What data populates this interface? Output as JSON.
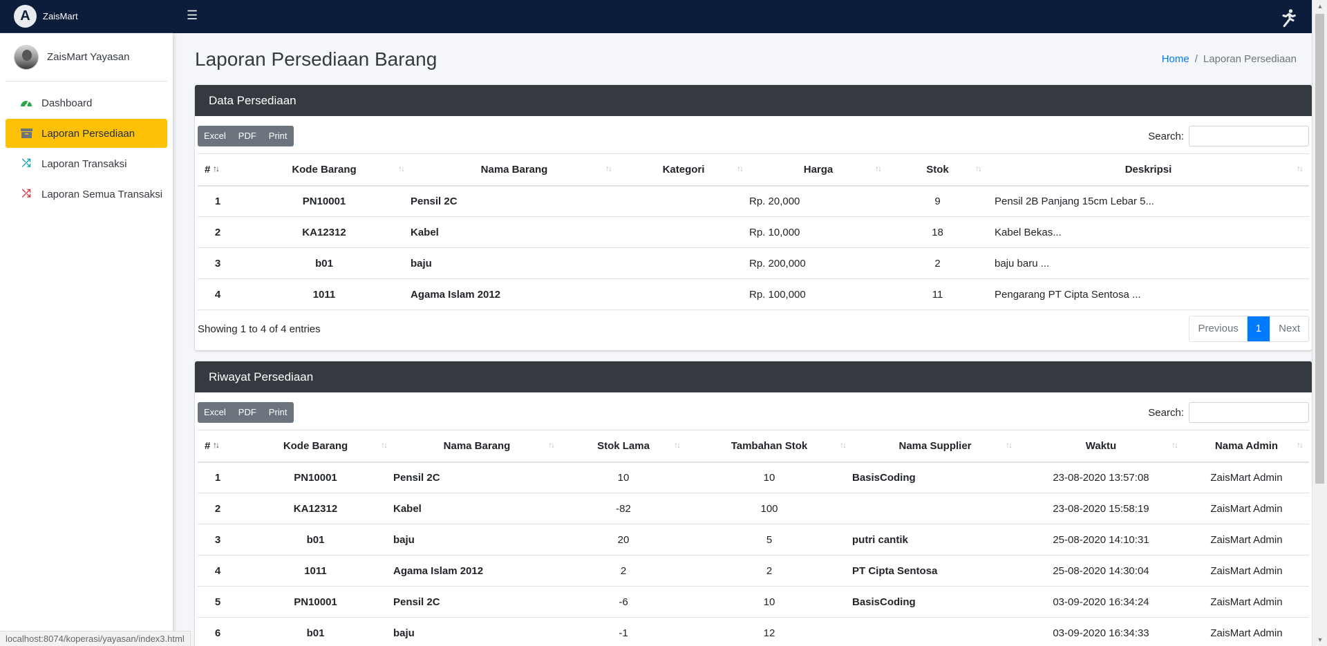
{
  "brand": {
    "name": "ZaisMart",
    "logo_letter": "A"
  },
  "navbar": {
    "menu_icon": "hamburger-icon",
    "right_icon": "running-man-icon"
  },
  "sidebar": {
    "user_name": "ZaisMart Yayasan",
    "items": [
      {
        "label": "Dashboard",
        "icon": "tachometer-icon",
        "icon_color": "#28a745",
        "active": false
      },
      {
        "label": "Laporan Persediaan",
        "icon": "archive-icon",
        "icon_color": "#6c757d",
        "active": true
      },
      {
        "label": "Laporan Transaksi",
        "icon": "shuffle-icon",
        "icon_color": "#17a2b8",
        "active": false
      },
      {
        "label": "Laporan Semua Transaksi",
        "icon": "shuffle-icon",
        "icon_color": "#dc3545",
        "active": false
      }
    ]
  },
  "page": {
    "title": "Laporan Persediaan Barang",
    "breadcrumb": {
      "home": "Home",
      "separator": "/",
      "current": "Laporan Persediaan"
    }
  },
  "persediaan": {
    "title": "Data Persediaan",
    "buttons": {
      "excel": "Excel",
      "pdf": "PDF",
      "print": "Print"
    },
    "search_label": "Search:",
    "columns": [
      "#",
      "Kode Barang",
      "Nama Barang",
      "Kategori",
      "Harga",
      "Stok",
      "Deskripsi"
    ],
    "rows": [
      [
        "1",
        "PN10001",
        "Pensil 2C",
        "",
        "Rp. 20,000",
        "9",
        "Pensil 2B Panjang 15cm Lebar 5..."
      ],
      [
        "2",
        "KA12312",
        "Kabel",
        "",
        "Rp. 10,000",
        "18",
        "Kabel Bekas..."
      ],
      [
        "3",
        "b01",
        "baju",
        "",
        "Rp. 200,000",
        "2",
        "baju baru ..."
      ],
      [
        "4",
        "1011",
        "Agama Islam 2012",
        "",
        "Rp. 100,000",
        "11",
        "Pengarang PT Cipta Sentosa ..."
      ]
    ],
    "info": "Showing 1 to 4 of 4 entries",
    "pagination": {
      "previous": "Previous",
      "page": "1",
      "next": "Next"
    }
  },
  "riwayat": {
    "title": "Riwayat Persediaan",
    "buttons": {
      "excel": "Excel",
      "pdf": "PDF",
      "print": "Print"
    },
    "search_label": "Search:",
    "columns": [
      "#",
      "Kode Barang",
      "Nama Barang",
      "Stok Lama",
      "Tambahan Stok",
      "Nama Supplier",
      "Waktu",
      "Nama Admin"
    ],
    "rows": [
      [
        "1",
        "PN10001",
        "Pensil 2C",
        "10",
        "10",
        "BasisCoding",
        "23-08-2020 13:57:08",
        "ZaisMart Admin"
      ],
      [
        "2",
        "KA12312",
        "Kabel",
        "-82",
        "100",
        "",
        "23-08-2020 15:58:19",
        "ZaisMart Admin"
      ],
      [
        "3",
        "b01",
        "baju",
        "20",
        "5",
        "putri cantik",
        "25-08-2020 14:10:31",
        "ZaisMart Admin"
      ],
      [
        "4",
        "1011",
        "Agama Islam 2012",
        "2",
        "2",
        "PT Cipta Sentosa",
        "25-08-2020 14:30:04",
        "ZaisMart Admin"
      ],
      [
        "5",
        "PN10001",
        "Pensil 2C",
        "-6",
        "10",
        "BasisCoding",
        "03-09-2020 16:34:24",
        "ZaisMart Admin"
      ],
      [
        "6",
        "b01",
        "baju",
        "-1",
        "12",
        "",
        "03-09-2020 16:34:33",
        "ZaisMart Admin"
      ]
    ]
  },
  "status_url": "localhost:8074/koperasi/yayasan/index3.html"
}
